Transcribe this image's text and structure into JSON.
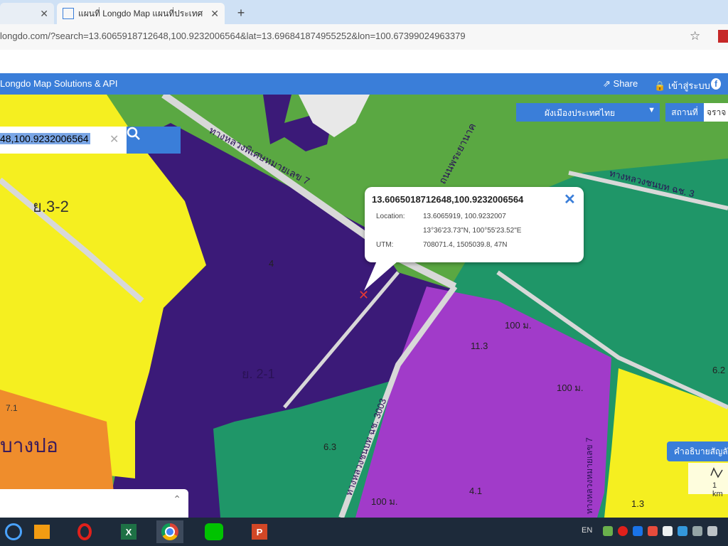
{
  "browser": {
    "tabs": [
      {
        "title": "",
        "active": false
      },
      {
        "title": "แผนที่ Longdo Map แผนที่ประเทศ",
        "active": true
      }
    ],
    "new_tab_label": "+",
    "url": "longdo.com/?search=13.6065918712648,100.9232006564&lat=13.696841874955252&lon=100.67399024963379"
  },
  "site": {
    "brand": "Longdo Map Solutions & API",
    "share_label": "Share",
    "login_label": "เข้าสู่ระบบ",
    "facebook_icon": "f"
  },
  "map": {
    "search_value": "48,100.9232006564",
    "layer_select": "ผังเมืองประเทศไทย",
    "place_button": "สถานที่",
    "place_input": "จราจ",
    "popup": {
      "title": "13.6065018712648,100.9232006564",
      "location_label": "Location:",
      "location_decimal": "13.6065919, 100.9232007",
      "location_dms": "13°36'23.73\"N, 100°55'23.52\"E",
      "utm_label": "UTM:",
      "utm_value": "708071.4, 1505039.8, 47N"
    },
    "legend_button": "คำอธิบายสัญลักษณ์",
    "scale_label": "1 km",
    "labels": {
      "zone_y32": "ย.3-2",
      "zone_banpo": "บางปอ",
      "zone_71": "7.1",
      "zone_purple": "ย. 2-1",
      "num_113": "11.3",
      "num_100m_a": "100 ม.",
      "num_100m_b": "100 ม.",
      "num_100m_c": "100 ม.",
      "num_63": "6.3",
      "num_41": "4.1",
      "num_13": "1.3",
      "num_62": "6.2",
      "num_4": "4",
      "road_1": "ทางหลวงพิเศษหมายเลข 7",
      "road_2": "ทางหลวงชนบท ฉช. 3003",
      "road_3": "ทางหลวงชนบท ฉช. 3",
      "road_4": "ทางหลวงหมายเลข 7",
      "road_5": "ถนนพระยานาค"
    }
  },
  "taskbar": {
    "lang": "EN",
    "apps": [
      "windows-media-player",
      "opera",
      "excel",
      "chrome",
      "line",
      "powerpoint"
    ]
  },
  "colors": {
    "accent": "#3a7ed9",
    "zone_purple": "#3b1a78",
    "zone_green_light": "#5aa842",
    "zone_green_dark": "#1f9668",
    "zone_yellow": "#f5ef20",
    "zone_orange": "#ef8d2c",
    "zone_magenta": "#a13bc9"
  }
}
